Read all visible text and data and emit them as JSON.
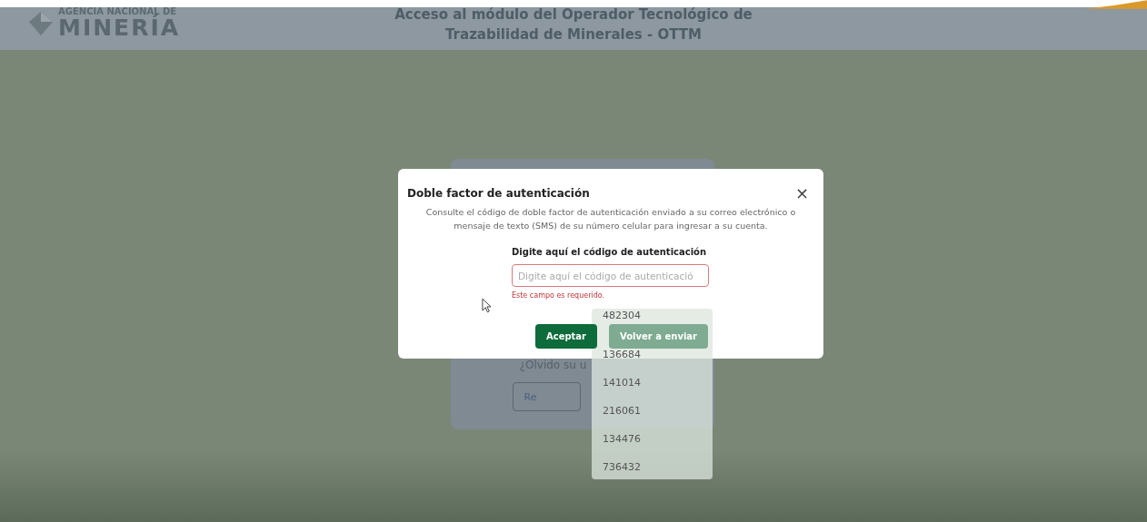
{
  "header": {
    "logo": {
      "line1": "AGENCIA NACIONAL DE",
      "line2": "MINERÍA"
    },
    "title_lines": [
      "Acceso al módulo del Operador Tecnológico de",
      "Trazabilidad de Minerales - OTTM"
    ]
  },
  "background_card": {
    "forgot_link": "¿Olvido su u",
    "button": "Re"
  },
  "dialog": {
    "title": "Doble factor de autenticación",
    "close": "×",
    "description": "Consulte el código de doble factor de autenticación enviado a su correo electrónico o mensaje de texto (SMS) de su número celular para ingresar a su cuenta.",
    "field_label": "Digite aquí el código de autenticación",
    "field": {
      "placeholder": "Digite aquí el código de autenticació",
      "error": "Este campo es requerido."
    },
    "buttons": [
      {
        "label": "Aceptar",
        "disabled": false
      },
      {
        "label": "Volver a enviar",
        "disabled": true
      }
    ]
  },
  "suggestions": [
    "482304",
    "136684",
    "141014",
    "216061",
    "134476",
    "736432"
  ]
}
